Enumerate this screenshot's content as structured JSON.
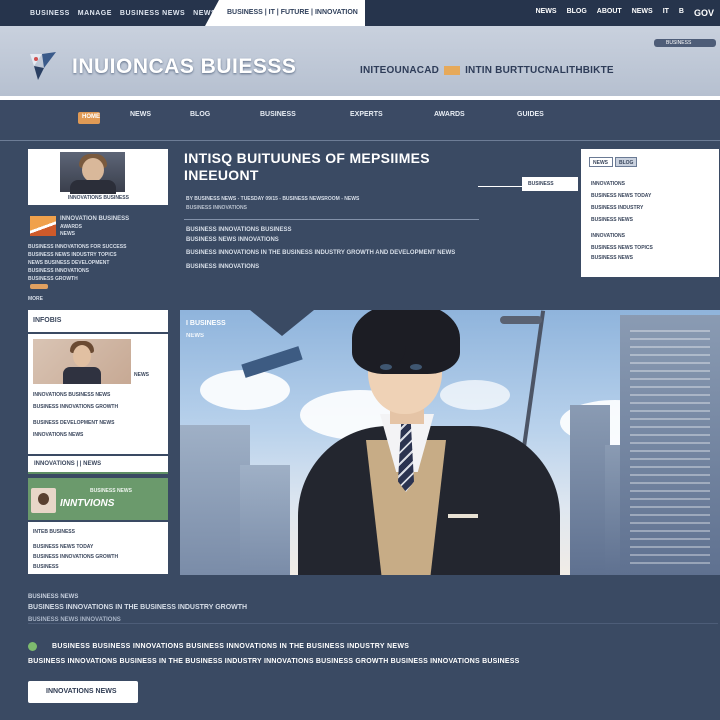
{
  "topbar": {
    "links": [
      "BUSINESS",
      "MANAGE",
      "BUSINESS NEWS",
      "NEWSROOM"
    ],
    "slant_text": "BUSINESS | IT | FUTURE | INNOVATION",
    "right_links": [
      "NEWS",
      "BLOG",
      "ABOUT",
      "NEWS",
      "IT",
      "B",
      "GOV"
    ]
  },
  "header": {
    "brand": "INUIONCAS BUIESSS",
    "tagline_a": "INITEOUNACAD",
    "tagline_b": "INTIN BURTTUCNALITHBIKTE",
    "pill": "BUSINESS"
  },
  "nav": {
    "home": "HOME",
    "items": [
      "NEWS",
      "BLOG",
      "BUSINESS",
      "EXPERTS",
      "AWARDS",
      "GUIDES"
    ]
  },
  "left_top": {
    "caption": "INNOVATIONS BUSINESS",
    "teaser_title": "INNOVATION BUSINESS",
    "teaser_sub": "AWARDS",
    "teaser_sub2": "NEWS",
    "lines": [
      "BUSINESS INNOVATIONS FOR SUCCESS",
      "BUSINESS NEWS INDUSTRY TOPICS",
      "NEWS BUSINESS DEVELOPMENT",
      "BUSINESS INNOVATIONS",
      "BUSINESS GROWTH"
    ],
    "more": "MORE"
  },
  "article": {
    "headline_1": "INTISQ BUITUUNES OF MEPSIIMES",
    "headline_2": "INEEUONT",
    "meta": "BY BUSINESS NEWS - TUESDAY 09/15 - BUSINESS NEWSROOM - NEWS",
    "p1": "BUSINESS INNOVATIONS BUSINESS",
    "p2": "BUSINESS NEWS INNOVATIONS",
    "p3": "BUSINESS INNOVATIONS IN THE BUSINESS INDUSTRY GROWTH AND DEVELOPMENT NEWS",
    "p4": "BUSINESS INNOVATIONS"
  },
  "callout": "BUSINESS",
  "right_sidebar": {
    "tabs": [
      "NEWS",
      "BLOG"
    ],
    "items": [
      "INNOVATIONS",
      "BUSINESS NEWS TODAY",
      "BUSINESS INDUSTRY",
      "BUSINESS NEWS",
      "INNOVATIONS",
      "BUSINESS NEWS TOPICS",
      "BUSINESS NEWS"
    ]
  },
  "left_lower": {
    "section_title": "INFOBIS",
    "story_tag": "NEWS",
    "story_lines": [
      "INNOVATIONS BUSINESS NEWS",
      "BUSINESS INNOVATIONS GROWTH",
      "BUSINESS DEVELOPMENT NEWS",
      "INNOVATIONS NEWS"
    ],
    "green_bar": "INNOVATIONS | | NEWS",
    "green_card_top": "BUSINESS NEWS",
    "green_card_title": "INNTVIONS",
    "white_lines": [
      "INTEB BUSINESS",
      "BUSINESS NEWS TODAY",
      "BUSINESS INNOVATIONS GROWTH",
      "BUSINESS"
    ]
  },
  "hero": {
    "label": "I BUSINESS",
    "sublabel": "NEWS"
  },
  "bottom": {
    "kicker": "BUSINESS NEWS",
    "line1": "BUSINESS INNOVATIONS IN THE BUSINESS INDUSTRY GROWTH",
    "line2": "BUSINESS NEWS INNOVATIONS",
    "row1": "BUSINESS  BUSINESS INNOVATIONS  BUSINESS INNOVATIONS IN THE BUSINESS INDUSTRY NEWS",
    "row2": "BUSINESS  INNOVATIONS BUSINESS IN THE BUSINESS INDUSTRY  INNOVATIONS BUSINESS GROWTH  BUSINESS INNOVATIONS BUSINESS",
    "cta": "INNOVATIONS NEWS"
  },
  "colors": {
    "page_bg": "#3a4a63",
    "accent_orange": "#e09a55",
    "accent_green": "#6b9a6c"
  }
}
